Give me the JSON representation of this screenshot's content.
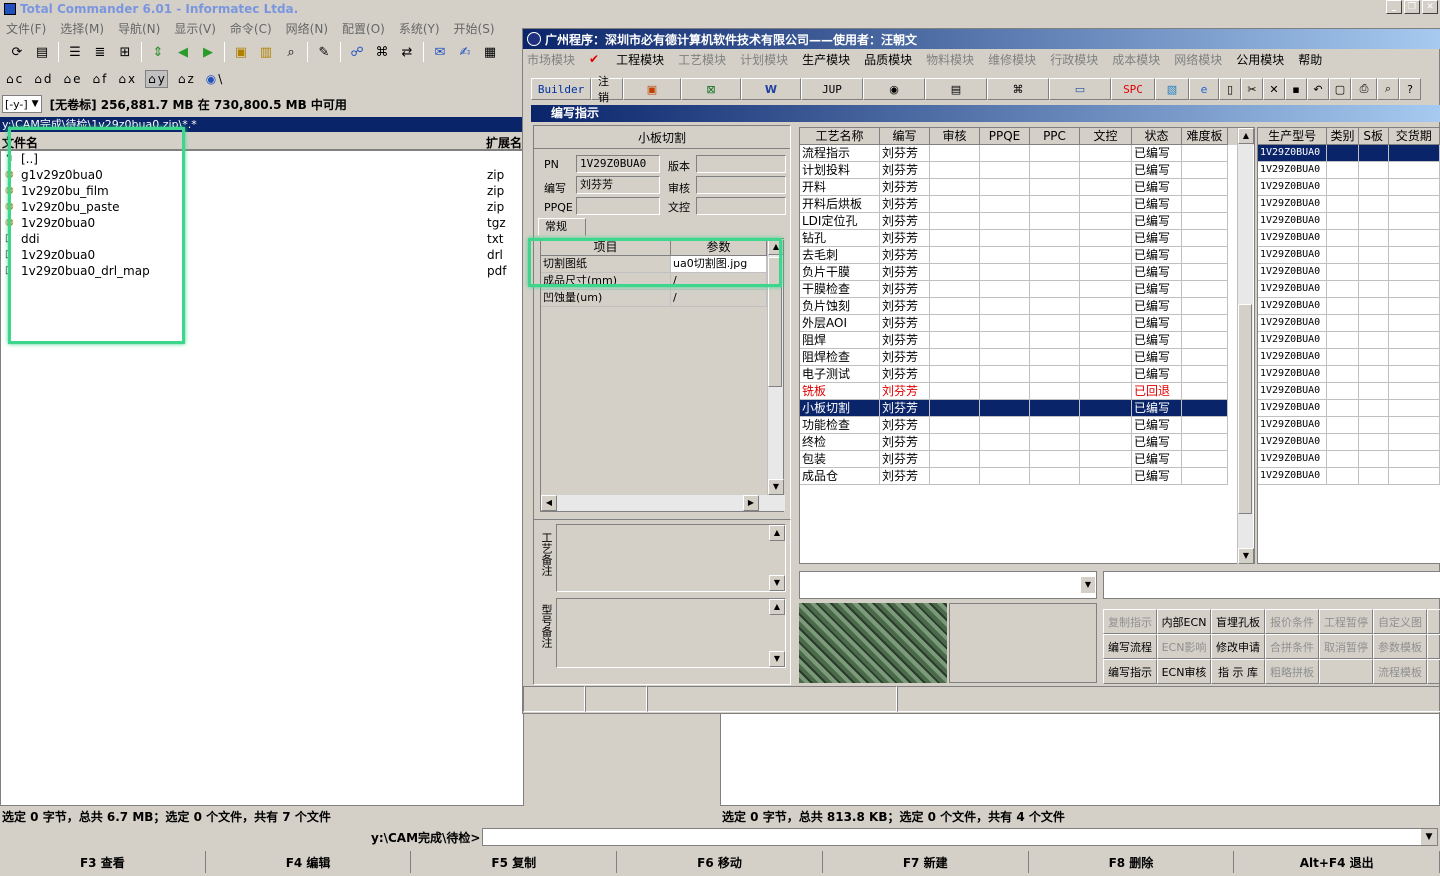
{
  "tc": {
    "title": "Total Commander 6.01 - Informatec Ltda.",
    "menu": [
      "文件(F)",
      "选择(M)",
      "导航(N)",
      "显示(V)",
      "命令(C)",
      "网络(N)",
      "配置(O)",
      "系统(Y)",
      "开始(S)"
    ],
    "drives": [
      "c",
      "d",
      "e",
      "f",
      "x",
      "y",
      "z",
      "\\"
    ],
    "drive_combo": "[-y-]",
    "volume_info": "[无卷标]  256,881.7 MB 在 730,800.5 MB 中可用",
    "current_path": "y:\\CAM完成\\待检\\1v29z0bua0.zip\\*.*",
    "col_name": "文件名",
    "col_ext": "扩展名",
    "files": [
      {
        "name": "[..]",
        "ext": ""
      },
      {
        "name": "g1v29z0bua0",
        "ext": "zip"
      },
      {
        "name": "1v29z0bu_film",
        "ext": "zip"
      },
      {
        "name": "1v29z0bu_paste",
        "ext": "zip"
      },
      {
        "name": "1v29z0bua0",
        "ext": "tgz"
      },
      {
        "name": "ddi",
        "ext": "txt"
      },
      {
        "name": "1v29z0bua0",
        "ext": "drl"
      },
      {
        "name": "1v29z0bua0_drl_map",
        "ext": "pdf"
      }
    ],
    "status_left": "选定 0 字节，总共 6.7 MB；选定 0 个文件，共有 7 个文件",
    "status_right": "选定 0 字节，总共 813.8 KB；选定 0 个文件，共有 4 个文件",
    "cmd_path": "y:\\CAM完成\\待检>",
    "fkeys": [
      "F3 查看",
      "F4 编辑",
      "F5 复制",
      "F6 移动",
      "F7 新建",
      "F8 删除",
      "Alt+F4 退出"
    ]
  },
  "app": {
    "title": "广州程序：深圳市必有德计算机软件技术有限公司——使用者：汪朝文",
    "menu": [
      {
        "label": "市场模块",
        "dim": true
      },
      {
        "label": "工程模块",
        "dim": false
      },
      {
        "label": "工艺模块",
        "dim": true
      },
      {
        "label": "计划模块",
        "dim": true
      },
      {
        "label": "生产模块",
        "dim": false
      },
      {
        "label": "品质模块",
        "dim": false
      },
      {
        "label": "物料模块",
        "dim": true
      },
      {
        "label": "维修模块",
        "dim": true
      },
      {
        "label": "行政模块",
        "dim": true
      },
      {
        "label": "成本模块",
        "dim": true
      },
      {
        "label": "网络模块",
        "dim": true
      },
      {
        "label": "公用模块",
        "dim": false
      },
      {
        "label": "帮助",
        "dim": false
      }
    ],
    "tools": {
      "builder": "Builder",
      "logout": "注销",
      "jup": "JUP",
      "spc": "SPC"
    },
    "subwindow_title": "编写指示",
    "form": {
      "header": "小板切割",
      "pn_label": "PN",
      "pn_value": "1V29Z0BUA0",
      "version_label": "版本",
      "writer_label": "编写",
      "writer_value": "刘芬芳",
      "review_label": "审核",
      "ppqe_label": "PPQE",
      "doc_label": "文控",
      "tab": "常规",
      "param_col1": "项目",
      "param_col2": "参数",
      "params": [
        {
          "item": "切割图纸",
          "value": "ua0切割图.jpg"
        },
        {
          "item": "成品尺寸(mm)",
          "value": "/"
        },
        {
          "item": "凹蚀量(um)",
          "value": "/"
        }
      ],
      "remark1": "工艺备注",
      "remark2": "型号备注"
    },
    "process_headers": [
      "工艺名称",
      "编写",
      "审核",
      "PPQE",
      "PPC",
      "文控",
      "状态",
      "难度板"
    ],
    "processes": [
      {
        "name": "流程指示",
        "writer": "刘芬芳",
        "status": "已编写"
      },
      {
        "name": "计划投料",
        "writer": "刘芬芳",
        "status": "已编写"
      },
      {
        "name": "开料",
        "writer": "刘芬芳",
        "status": "已编写"
      },
      {
        "name": "开料后烘板",
        "writer": "刘芬芳",
        "status": "已编写"
      },
      {
        "name": "LDI定位孔",
        "writer": "刘芬芳",
        "status": "已编写"
      },
      {
        "name": "钻孔",
        "writer": "刘芬芳",
        "status": "已编写"
      },
      {
        "name": "去毛刺",
        "writer": "刘芬芳",
        "status": "已编写"
      },
      {
        "name": "负片干膜",
        "writer": "刘芬芳",
        "status": "已编写"
      },
      {
        "name": "干膜检查",
        "writer": "刘芬芳",
        "status": "已编写"
      },
      {
        "name": "负片蚀刻",
        "writer": "刘芬芳",
        "status": "已编写"
      },
      {
        "name": "外层AOI",
        "writer": "刘芬芳",
        "status": "已编写"
      },
      {
        "name": "阻焊",
        "writer": "刘芬芳",
        "status": "已编写"
      },
      {
        "name": "阻焊检查",
        "writer": "刘芬芳",
        "status": "已编写"
      },
      {
        "name": "电子测试",
        "writer": "刘芬芳",
        "status": "已编写"
      },
      {
        "name": "铣板",
        "writer": "刘芬芳",
        "status": "已回退"
      },
      {
        "name": "小板切割",
        "writer": "刘芬芳",
        "status": "已编写"
      },
      {
        "name": "功能检查",
        "writer": "刘芬芳",
        "status": "已编写"
      },
      {
        "name": "终检",
        "writer": "刘芬芳",
        "status": "已编写"
      },
      {
        "name": "包装",
        "writer": "刘芬芳",
        "status": "已编写"
      },
      {
        "name": "成品仓",
        "writer": "刘芬芳",
        "status": "已编写"
      }
    ],
    "model_headers": [
      "生产型号",
      "类别",
      "S板",
      "交货期"
    ],
    "model_value": "1V29Z0BUA0",
    "buttons": [
      {
        "label": "复制指示",
        "dim": true
      },
      {
        "label": "内部ECN",
        "dim": false
      },
      {
        "label": "盲埋孔板",
        "dim": false
      },
      {
        "label": "报价条件",
        "dim": true
      },
      {
        "label": "工程暂停",
        "dim": true
      },
      {
        "label": "自定义图",
        "dim": true
      },
      {
        "label": "",
        "dim": true
      },
      {
        "label": "编写流程",
        "dim": false
      },
      {
        "label": "ECN影响",
        "dim": true
      },
      {
        "label": "修改申请",
        "dim": false
      },
      {
        "label": "合拼条件",
        "dim": true
      },
      {
        "label": "取消暂停",
        "dim": true
      },
      {
        "label": "参数模板",
        "dim": true
      },
      {
        "label": "",
        "dim": true
      },
      {
        "label": "编写指示",
        "dim": false
      },
      {
        "label": "ECN审核",
        "dim": false
      },
      {
        "label": "指 示 库",
        "dim": false
      },
      {
        "label": "粗略拼板",
        "dim": true
      },
      {
        "label": "",
        "dim": true
      },
      {
        "label": "流程模板",
        "dim": true
      },
      {
        "label": "",
        "dim": true
      }
    ]
  }
}
